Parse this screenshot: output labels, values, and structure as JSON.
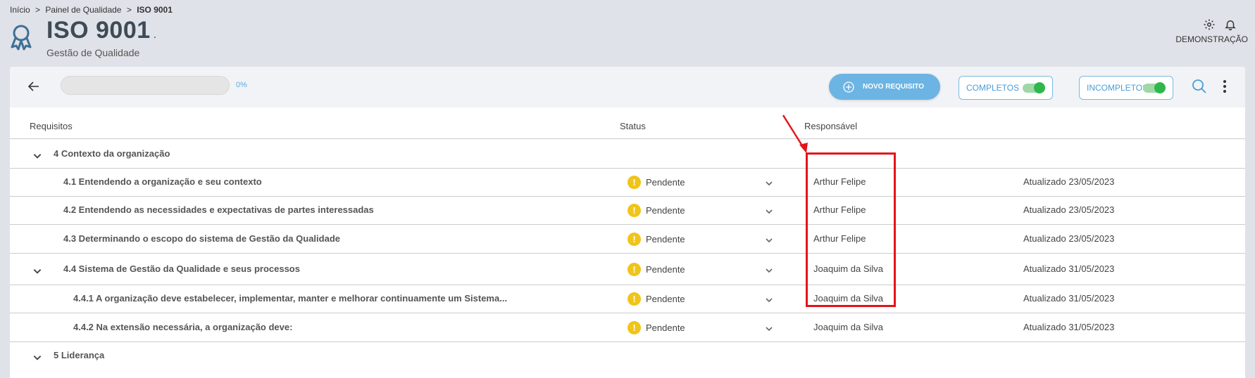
{
  "breadcrumb": {
    "items": [
      "Início",
      ">",
      "Painel de Qualidade",
      ">"
    ],
    "current": "ISO 9001"
  },
  "header": {
    "title": "ISO 9001",
    "title_suffix": ".",
    "subtitle": "Gestão de Qualidade",
    "user_label": "DEMONSTRAÇÃO"
  },
  "toolbar": {
    "progress_value": 0,
    "progress_text": "0%",
    "new_button_label": "NOVO REQUISITO",
    "completos_label": "COMPLETOS",
    "completos_on": true,
    "incompletos_label": "INCOMPLETOS",
    "incompletos_on": true
  },
  "table": {
    "headers": {
      "requisitos": "Requisitos",
      "status": "Status",
      "responsavel": "Responsável"
    },
    "rows": [
      {
        "title": "4 Contexto da organização",
        "group": true,
        "status": "",
        "responsible": "",
        "updated": ""
      },
      {
        "title": "4.1 Entendendo a organização e seu contexto",
        "status": "Pendente",
        "responsible": "Arthur Felipe",
        "updated": "Atualizado 23/05/2023"
      },
      {
        "title": "4.2 Entendendo as necessidades e expectativas de partes interessadas",
        "status": "Pendente",
        "responsible": "Arthur Felipe",
        "updated": "Atualizado 23/05/2023"
      },
      {
        "title": "4.3 Determinando o escopo do sistema de Gestão da Qualidade",
        "status": "Pendente",
        "responsible": "Arthur Felipe",
        "updated": "Atualizado 23/05/2023"
      },
      {
        "title": "4.4 Sistema de Gestão da Qualidade e seus processos",
        "status": "Pendente",
        "responsible": "Joaquim da Silva",
        "updated": "Atualizado 31/05/2023"
      },
      {
        "title": "4.4.1 A organização deve estabelecer, implementar, manter e melhorar continuamente um Sistema...",
        "status": "Pendente",
        "responsible": "Joaquim da Silva",
        "updated": "Atualizado 31/05/2023"
      },
      {
        "title": "4.4.2 Na extensão necessária, a organização deve:",
        "status": "Pendente",
        "responsible": "Joaquim da Silva",
        "updated": "Atualizado 31/05/2023"
      },
      {
        "title": "5 Liderança",
        "group": true,
        "status": "",
        "responsible": "",
        "updated": ""
      }
    ]
  },
  "colors": {
    "accent": "#6cb4e3",
    "warning": "#f0c419",
    "toggle_on": "#2eb84b",
    "highlight": "#e5141b"
  },
  "icons": {
    "logo": "award-ribbon-icon",
    "settings": "gear-icon",
    "notifications": "bell-icon",
    "back": "arrow-left-icon",
    "add": "plus-circle-icon",
    "search": "search-icon",
    "more": "more-vertical-icon",
    "expand": "chevron-down-icon",
    "status": "warning-icon"
  }
}
